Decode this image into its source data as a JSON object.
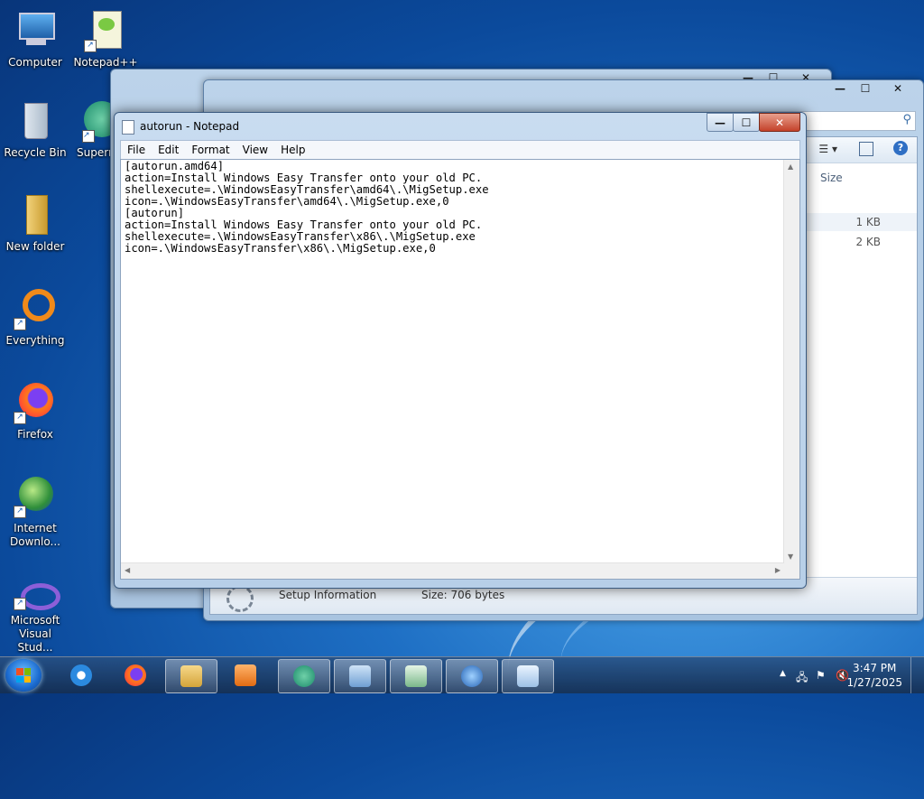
{
  "desktop": {
    "icons": [
      {
        "label": "Computer"
      },
      {
        "label": "Notepad++"
      },
      {
        "label": "Recycle Bin"
      },
      {
        "label": "Superr"
      },
      {
        "label": "New folder"
      },
      {
        "label": "Everything"
      },
      {
        "label": "Firefox"
      },
      {
        "label": "Internet Downlo..."
      },
      {
        "label": "Microsoft Visual Stud..."
      }
    ]
  },
  "explorer": {
    "column_size": "Size",
    "rows": [
      {
        "size": "1 KB"
      },
      {
        "size": "2 KB"
      }
    ],
    "status_type": "Setup Information",
    "status_size": "Size: 706 bytes"
  },
  "notepad": {
    "title": "autorun - Notepad",
    "menu": [
      "File",
      "Edit",
      "Format",
      "View",
      "Help"
    ],
    "content": "[autorun.amd64]\naction=Install Windows Easy Transfer onto your old PC.\nshellexecute=.\\WindowsEasyTransfer\\amd64\\.\\MigSetup.exe\nicon=.\\WindowsEasyTransfer\\amd64\\.\\MigSetup.exe,0\n[autorun]\naction=Install Windows Easy Transfer onto your old PC.\nshellexecute=.\\WindowsEasyTransfer\\x86\\.\\MigSetup.exe\nicon=.\\WindowsEasyTransfer\\x86\\.\\MigSetup.exe,0",
    "buttons": {
      "minimize": "—",
      "maximize": "☐",
      "close": "✕"
    }
  },
  "taskbar": {
    "time": "3:47 PM",
    "date": "1/27/2025"
  }
}
